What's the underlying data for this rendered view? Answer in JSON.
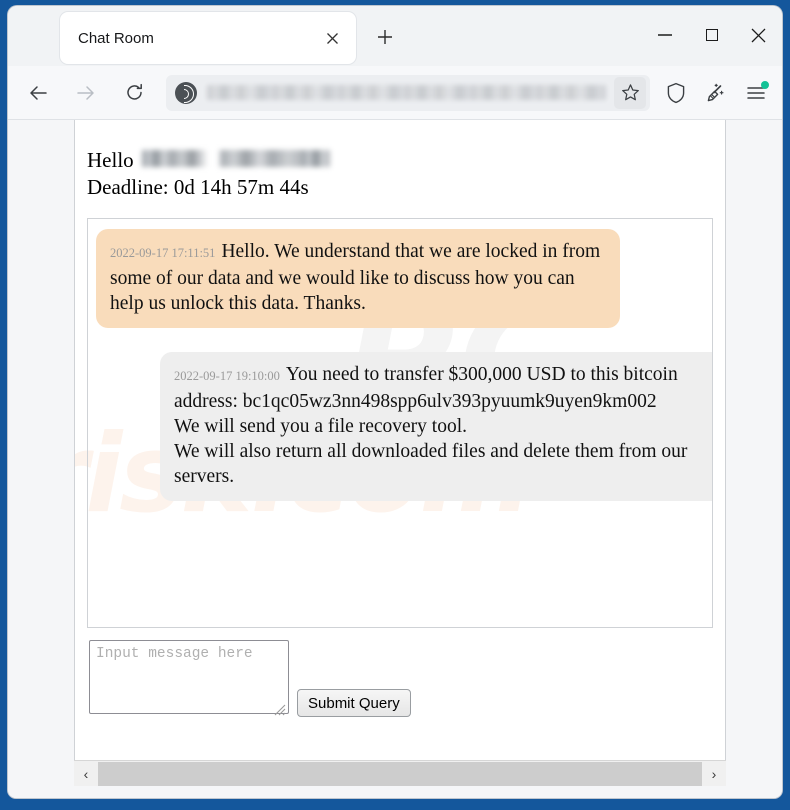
{
  "browser": {
    "tab": {
      "title": "Chat Room",
      "close_icon": "close-icon"
    },
    "new_tab_label": "+",
    "window_controls": {
      "minimize": "–",
      "maximize": "",
      "close": "✕"
    },
    "nav": {
      "back_icon": "back-arrow-icon",
      "forward_icon": "forward-arrow-icon",
      "reload_icon": "reload-icon",
      "url_value": "",
      "site_icon": "tor-onion-icon",
      "bookmark_icon": "star-icon",
      "shield_icon": "shield-icon",
      "cleanup_icon": "broom-icon",
      "menu_icon": "hamburger-menu-icon",
      "menu_badge": "update-available-dot"
    }
  },
  "page": {
    "watermark_lower": "risk.com",
    "watermark_upper": "PC",
    "greeting": "Hello",
    "greeting_name_redacted": true,
    "deadline": "Deadline: 0d 14h 57m 44s",
    "messages": [
      {
        "side": "left",
        "timestamp": "2022-09-17 17:11:51",
        "text": "Hello. We understand that we are locked in from some of our data and we would like to discuss how you can help us unlock this data. Thanks."
      },
      {
        "side": "right",
        "timestamp": "2022-09-17 19:10:00",
        "text": "You need to transfer $300,000 USD to this bitcoin address: bc1qc05wz3nn498spp6ulv393pyuumk9uyen9km002\nWe will send you a file recovery tool.\nWe will also return all downloaded files and delete them from our servers."
      }
    ],
    "composer": {
      "placeholder": "Input message here",
      "value": "",
      "submit_label": "Submit Query"
    },
    "scrollbar": {
      "left_arrow": "‹",
      "right_arrow": "›"
    }
  },
  "colors": {
    "window_border": "#14579c",
    "bubble_incoming": "#f9dcbb",
    "bubble_outgoing": "#eeeeee",
    "menu_badge": "#13c296"
  }
}
